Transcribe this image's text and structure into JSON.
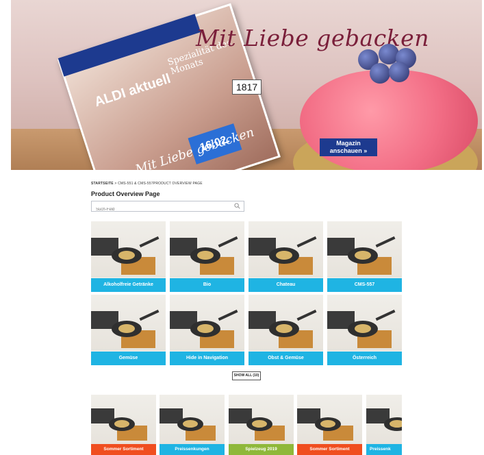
{
  "hero": {
    "title": "Mit Liebe gebacken",
    "magazine_logo": "ALDI aktuell",
    "magazine_special": "Spezialität des Monats",
    "magazine_date": "16.02.",
    "magazine_subtitle": "Mit Liebe gebacken",
    "counter": "1817",
    "button_line1": "Magazin",
    "button_line2": "anschauen »"
  },
  "breadcrumb": {
    "home": "STARTSEITE",
    "separator": ">",
    "current": "CMS-551 & CMS-557PRODUCT OVERVIEW PAGE"
  },
  "page_title": "Product Overview Page",
  "search": {
    "placeholder": "Such-Feld",
    "icon": "search-icon"
  },
  "categories": [
    {
      "label": "Alkoholfreie Getränke"
    },
    {
      "label": "Bio"
    },
    {
      "label": "Chateau"
    },
    {
      "label": "CMS-557"
    },
    {
      "label": "Gemüse"
    },
    {
      "label": "Hide in Navigation"
    },
    {
      "label": "Obst & Gemüse"
    },
    {
      "label": "Österreich"
    }
  ],
  "show_all": "SHOW ALL (10)",
  "promos": [
    {
      "label": "Sommer Sortiment",
      "color": "#f04e1f"
    },
    {
      "label": "Preissenkungen",
      "color": "#1fb4e3"
    },
    {
      "label": "Spielzeug 2019",
      "color": "#8fb83a"
    },
    {
      "label": "Sommer Sortiment",
      "color": "#f04e1f"
    },
    {
      "label": "Preissenk",
      "color": "#1fb4e3"
    }
  ],
  "colors": {
    "category_label": "#1fb4e3",
    "brand_blue": "#1d3a8f"
  }
}
